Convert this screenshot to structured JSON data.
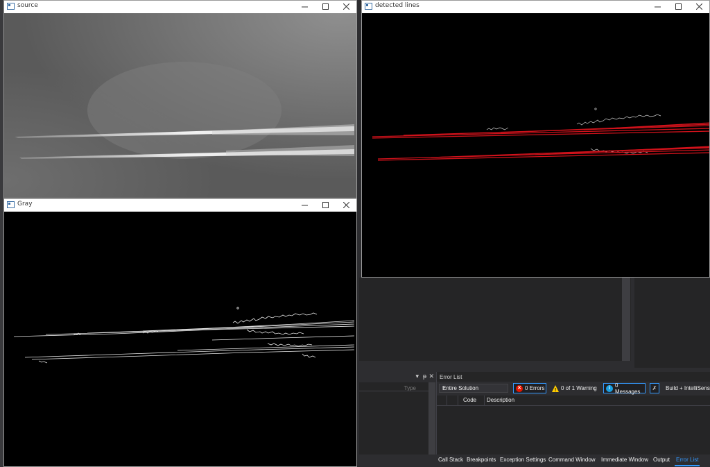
{
  "windows": {
    "source": {
      "title": "source"
    },
    "gray": {
      "title": "Gray"
    },
    "detected": {
      "title": "detected lines"
    }
  },
  "colors": {
    "line_red": "#d0121b",
    "edge_white": "#e6e6e6",
    "accent_blue": "#3399ff",
    "vs_dark": "#2d2d30"
  },
  "side_panel": {
    "type_label": "Type"
  },
  "error_list": {
    "title": "Error List",
    "scope": "Entire Solution",
    "errors_label": "0 Errors",
    "warnings_label": "0 of 1 Warning",
    "messages_label": "0 Messages",
    "build_label": "Build + IntelliSens",
    "columns": {
      "code": "Code",
      "description": "Description"
    }
  },
  "tabs": [
    "Call Stack",
    "Breakpoints",
    "Exception Settings",
    "Command Window",
    "Immediate Window",
    "Output",
    "Error List"
  ]
}
